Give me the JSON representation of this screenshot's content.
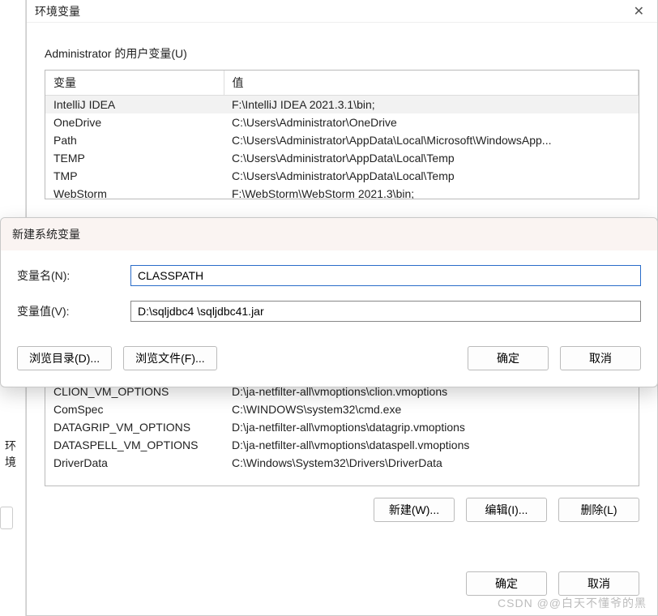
{
  "side": {
    "label": "环境"
  },
  "envWindow": {
    "title": "环境变量",
    "userSectionLabel": "Administrator 的用户变量(U)",
    "columns": {
      "var": "变量",
      "val": "值"
    },
    "userVars": [
      {
        "name": "IntelliJ IDEA",
        "value": "F:\\IntelliJ IDEA 2021.3.1\\bin;"
      },
      {
        "name": "OneDrive",
        "value": "C:\\Users\\Administrator\\OneDrive"
      },
      {
        "name": "Path",
        "value": "C:\\Users\\Administrator\\AppData\\Local\\Microsoft\\WindowsApp..."
      },
      {
        "name": "TEMP",
        "value": "C:\\Users\\Administrator\\AppData\\Local\\Temp"
      },
      {
        "name": "TMP",
        "value": "C:\\Users\\Administrator\\AppData\\Local\\Temp"
      },
      {
        "name": "WebStorm",
        "value": "F:\\WebStorm\\WebStorm 2021.3\\bin;"
      }
    ],
    "sysVars": [
      {
        "name": "CLION_VM_OPTIONS",
        "value": "D:\\ja-netfilter-all\\vmoptions\\clion.vmoptions"
      },
      {
        "name": "ComSpec",
        "value": "C:\\WINDOWS\\system32\\cmd.exe"
      },
      {
        "name": "DATAGRIP_VM_OPTIONS",
        "value": "D:\\ja-netfilter-all\\vmoptions\\datagrip.vmoptions"
      },
      {
        "name": "DATASPELL_VM_OPTIONS",
        "value": "D:\\ja-netfilter-all\\vmoptions\\dataspell.vmoptions"
      },
      {
        "name": "DriverData",
        "value": "C:\\Windows\\System32\\Drivers\\DriverData"
      }
    ],
    "buttons": {
      "new": "新建(W)...",
      "edit": "编辑(I)...",
      "delete": "删除(L)",
      "ok": "确定",
      "cancel": "取消"
    }
  },
  "modal": {
    "title": "新建系统变量",
    "nameLabel": "变量名(N):",
    "valueLabel": "变量值(V):",
    "nameValue": "CLASSPATH",
    "valueValue": "D:\\sqljdbc4 \\sqljdbc41.jar",
    "browseDir": "浏览目录(D)...",
    "browseFile": "浏览文件(F)...",
    "ok": "确定",
    "cancel": "取消"
  },
  "watermark": "CSDN @@白天不懂爷的黑"
}
